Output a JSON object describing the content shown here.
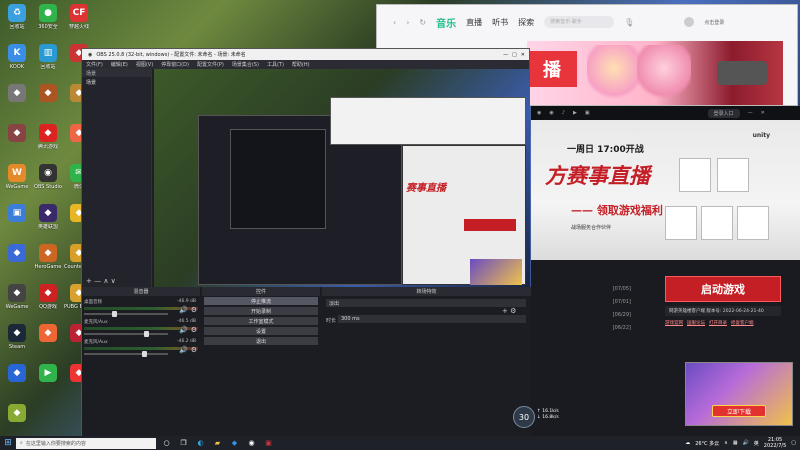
{
  "desktop": {
    "icons": [
      {
        "label": "回收站",
        "glyph": "♻",
        "color": "#3aa0e0"
      },
      {
        "label": "360安全",
        "glyph": "●",
        "color": "#2fb34a"
      },
      {
        "label": "穿越火线",
        "glyph": "CF",
        "color": "#d33"
      },
      {
        "label": "KOOK",
        "glyph": "K",
        "color": "#3a8ee6"
      },
      {
        "label": "回收站",
        "glyph": "▥",
        "color": "#2a9ad5"
      },
      {
        "label": "",
        "glyph": "◆",
        "color": "#c33"
      },
      {
        "label": "",
        "glyph": "◆",
        "color": "#777"
      },
      {
        "label": "",
        "glyph": "◆",
        "color": "#a52"
      },
      {
        "label": "",
        "glyph": "◆",
        "color": "#b83"
      },
      {
        "label": "",
        "glyph": "◆",
        "color": "#844"
      },
      {
        "label": "腾讯游戏",
        "glyph": "◆",
        "color": "#d22"
      },
      {
        "label": "",
        "glyph": "◆",
        "color": "#e64"
      },
      {
        "label": "WeGame",
        "glyph": "W",
        "color": "#e48a2a"
      },
      {
        "label": "OBS Studio",
        "glyph": "◉",
        "color": "#333"
      },
      {
        "label": "微信",
        "glyph": "✉",
        "color": "#2fb34a"
      },
      {
        "label": "",
        "glyph": "▣",
        "color": "#3b7dd8"
      },
      {
        "label": "英雄联盟",
        "glyph": "◆",
        "color": "#3a2a6a"
      },
      {
        "label": "",
        "glyph": "◆",
        "color": "#e8b525"
      },
      {
        "label": "",
        "glyph": "◆",
        "color": "#3a6ad5"
      },
      {
        "label": "HeroGame",
        "glyph": "◆",
        "color": "#c62"
      },
      {
        "label": "Counter-Strike Global",
        "glyph": "◆",
        "color": "#d8a028"
      },
      {
        "label": "WeGame",
        "glyph": "◆",
        "color": "#444"
      },
      {
        "label": "QQ游戏",
        "glyph": "◆",
        "color": "#c22"
      },
      {
        "label": "PUBG BATTLEGR",
        "glyph": "◆",
        "color": "#d9a12d"
      },
      {
        "label": "Steam",
        "glyph": "◆",
        "color": "#1b2838"
      },
      {
        "label": "",
        "glyph": "◆",
        "color": "#e63"
      },
      {
        "label": "",
        "glyph": "◆",
        "color": "#b23"
      },
      {
        "label": "",
        "glyph": "◆",
        "color": "#2766d4"
      },
      {
        "label": "",
        "glyph": "▶",
        "color": "#2fb34a"
      },
      {
        "label": "",
        "glyph": "◆",
        "color": "#e33"
      },
      {
        "label": "",
        "glyph": "◆",
        "color": "#8a3"
      }
    ]
  },
  "music_window": {
    "tabs": [
      "音乐",
      "直播",
      "听书",
      "探索"
    ],
    "search_placeholder": "搜索音乐·歌手",
    "banner_text": "播",
    "user_label": "点击登录",
    "window_controls": [
      "—",
      "□",
      "✕"
    ]
  },
  "obs": {
    "title": "OBS 25.0.8 (32-bit, windows) - 配置文件: 未命名 - 场景: 未命名",
    "menu": [
      "文件(F)",
      "编辑(E)",
      "视图(V)",
      "停靠窗口(D)",
      "配置文件(P)",
      "场景集合(S)",
      "工具(T)",
      "帮助(H)"
    ],
    "left_panel_title": "场景",
    "left_panel_item": "场景",
    "dock_titles": {
      "mixer": "混音器",
      "controls": "控件",
      "transitions": "转场特效"
    },
    "mixer_tracks": [
      {
        "name": "桌面音频",
        "db": "-46.9 dB",
        "level": 0.35
      },
      {
        "name": "麦克风/Aux",
        "db": "-46.5 dB",
        "level": 0.75
      },
      {
        "name": "麦克风/Aux",
        "db": "-46.2 dB",
        "level": 0.72
      }
    ],
    "control_buttons": [
      "停止推流",
      "开始录制",
      "工作室模式",
      "设置",
      "退出"
    ],
    "transition_type": "淡出",
    "duration_label": "时长",
    "duration_value": "300 ms"
  },
  "game_launcher": {
    "top_text": "一周日 17:00开战",
    "title": "方赛事直播",
    "subtitle": "—— 领取游戏福利",
    "note": "战场服务合作伙伴",
    "launch_label": "启动游戏",
    "version": "网游英雄楼客户端 版本号: 2022-06-24-21-40",
    "links": [
      "游戏官网",
      "国服论坛",
      "打开目录",
      "修复客户端"
    ],
    "news_dates": [
      "[07/05]",
      "[07/01]",
      "[06/29]",
      "[06/22]"
    ],
    "promo_button": "立即下载",
    "brand": "unity",
    "login_placeholder": "登录入口"
  },
  "overlay": {
    "fps": "30",
    "net_up": "↑ 16.1k/s",
    "net_down": "↓ 16.8k/s"
  },
  "taskbar": {
    "search_placeholder": "在这里输入你要搜索的内容",
    "weather": "26°C 多云",
    "time": "21:05",
    "date": "2022/7/5",
    "ime": "英"
  }
}
